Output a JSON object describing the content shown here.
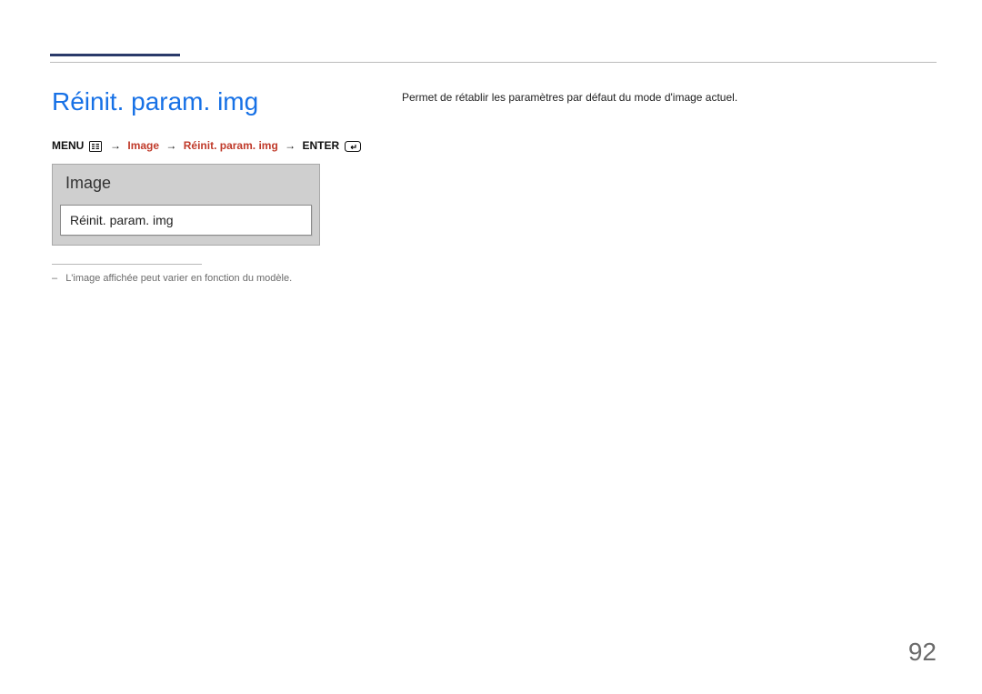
{
  "title": "Réinit. param. img",
  "breadcrumb": {
    "menu_label": "MENU",
    "menu_icon": "menu-icon",
    "arrow": "→",
    "path_image": "Image",
    "path_reset": "Réinit. param. img",
    "enter_label": "ENTER",
    "enter_icon": "enter-icon"
  },
  "panel": {
    "title": "Image",
    "item_label": "Réinit. param. img"
  },
  "footnote": {
    "dash": "–",
    "text": "L'image affichée peut varier en fonction du modèle."
  },
  "description": "Permet de rétablir les paramètres par défaut du mode d'image actuel.",
  "page_number": "92"
}
